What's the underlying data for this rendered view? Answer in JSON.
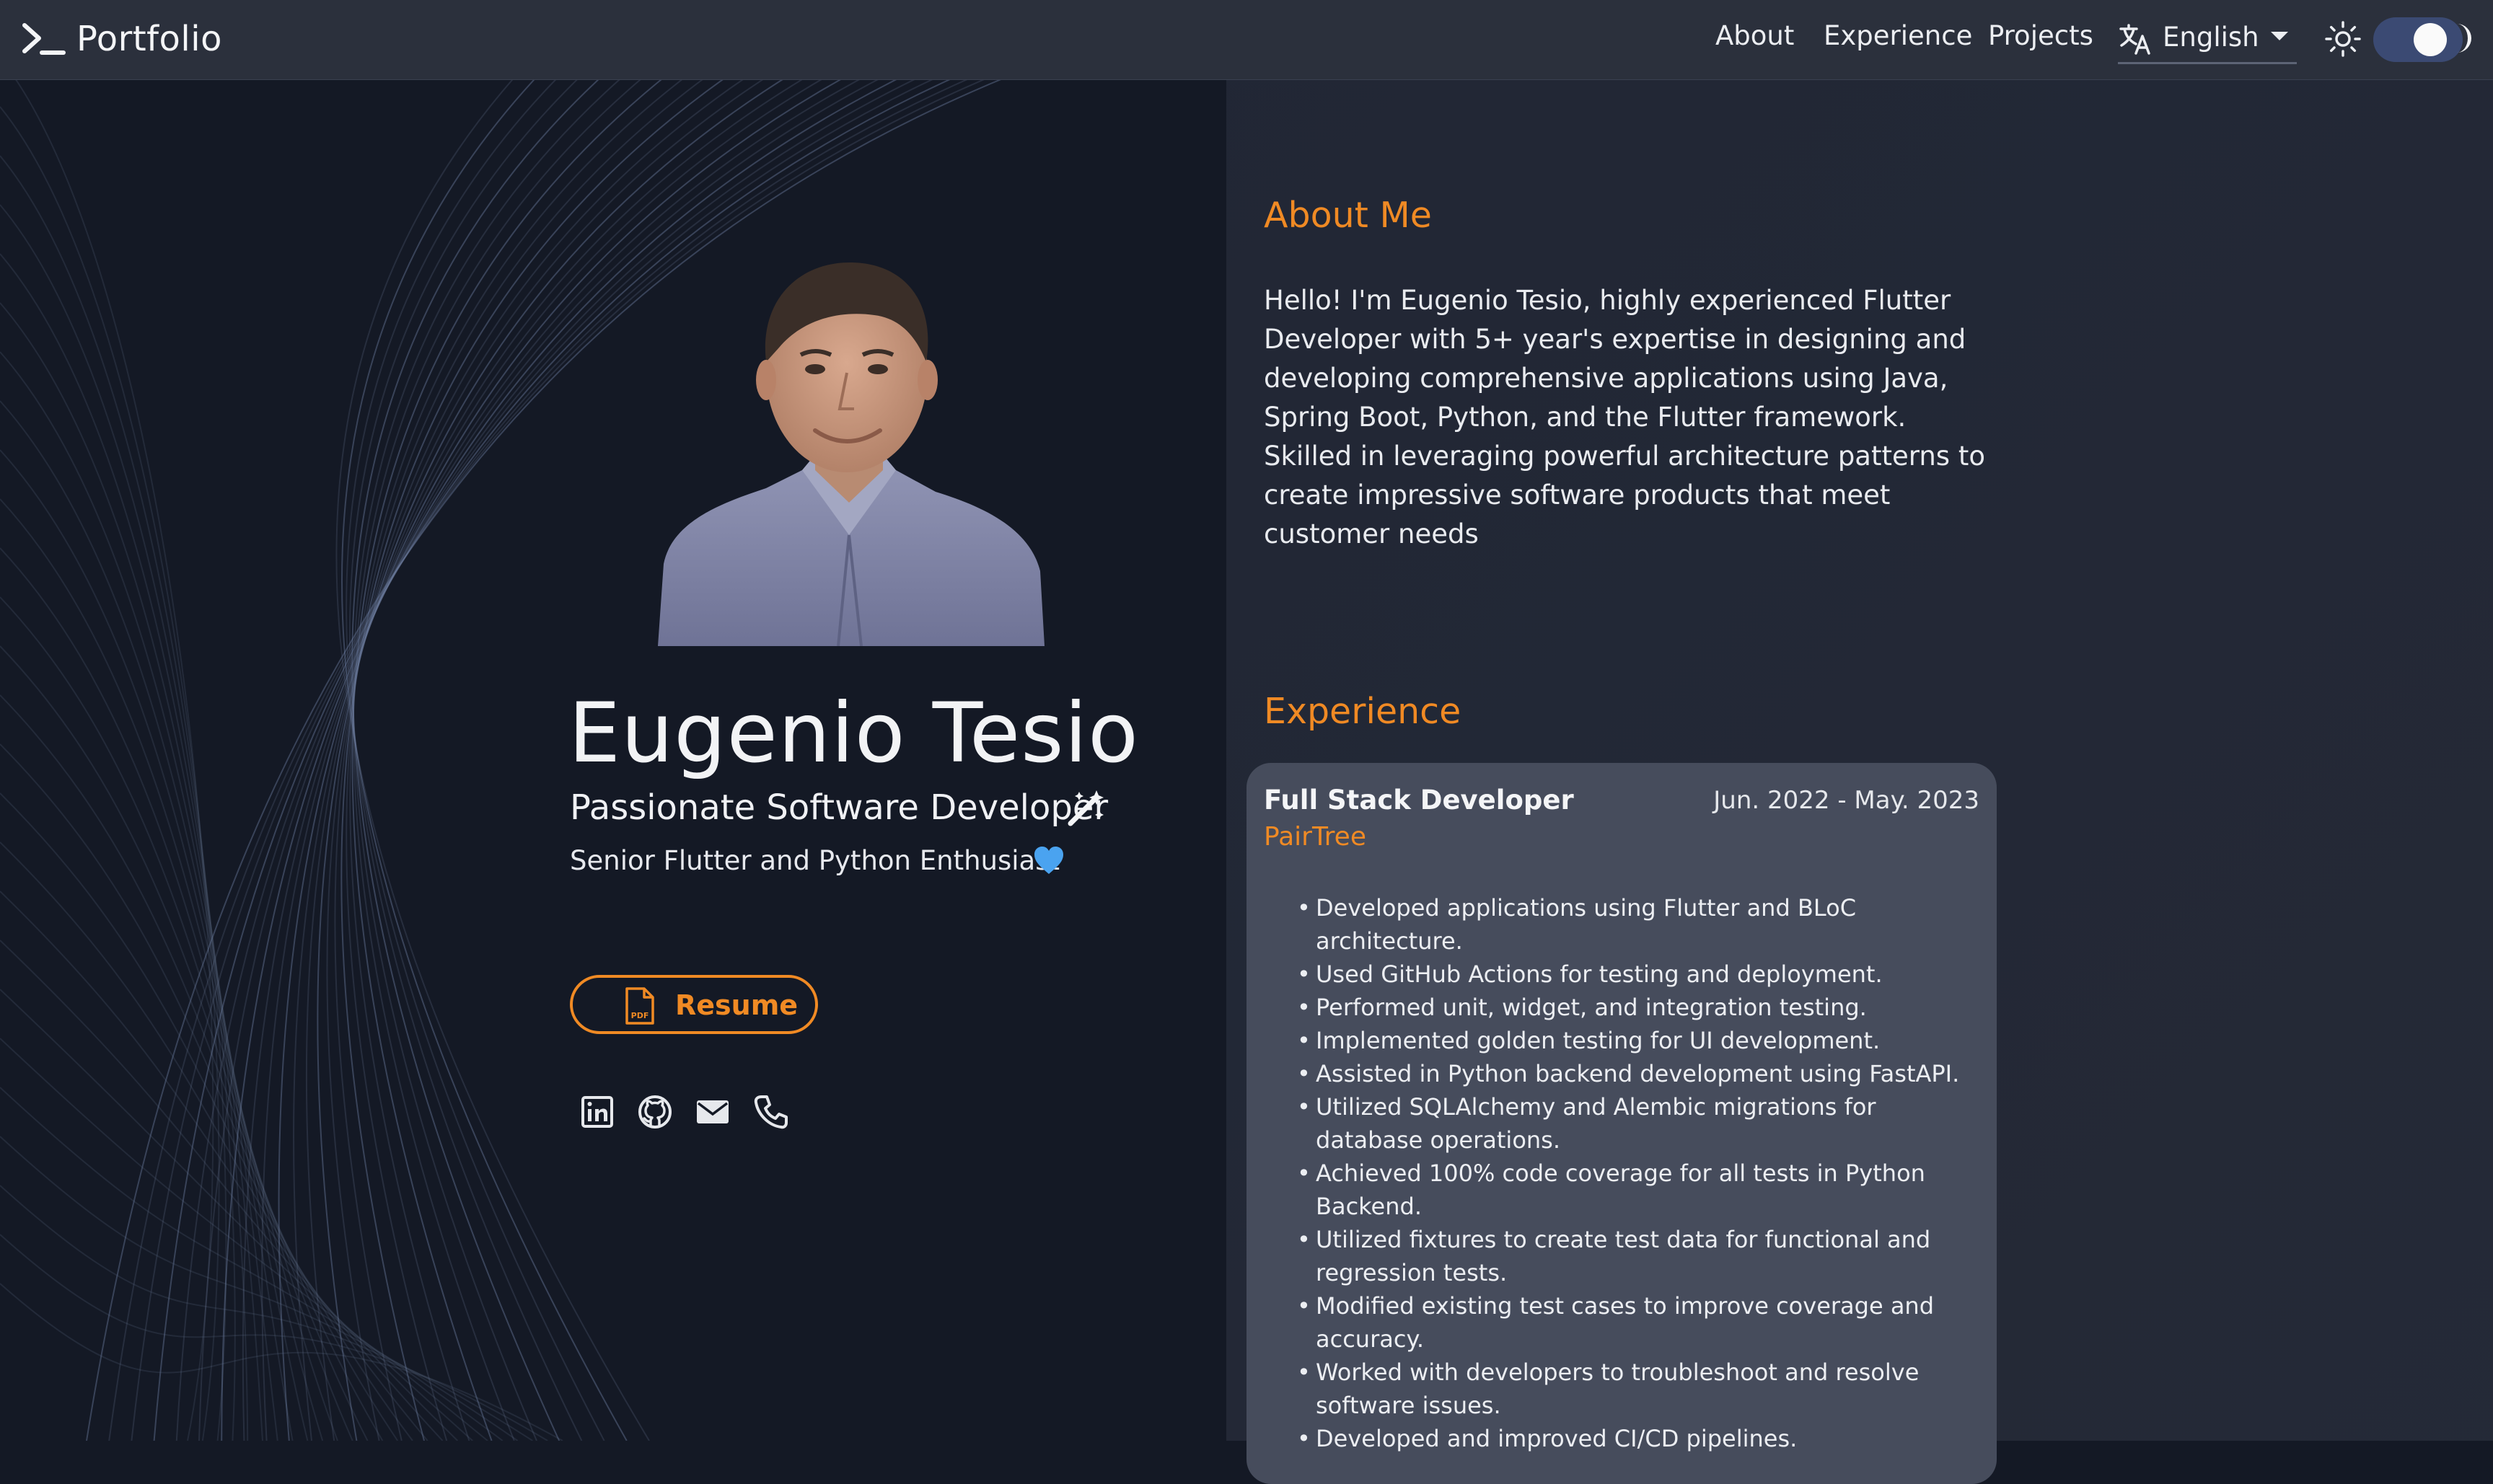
{
  "brand": {
    "text": "Portfolio"
  },
  "nav": {
    "links": [
      "About",
      "Experience",
      "Projects"
    ],
    "language": "English"
  },
  "hero": {
    "name": "Eugenio Tesio",
    "role": "Passionate Software Developer",
    "tagline": "Senior Flutter and Python Enthusiast",
    "resume_label": "Resume",
    "pdf_badge": "PDF",
    "social_icons": [
      "linkedin-icon",
      "github-icon",
      "mail-icon",
      "phone-icon"
    ]
  },
  "about": {
    "title": "About Me",
    "text": "Hello! I'm Eugenio Tesio, highly experienced Flutter Developer with 5+ year's expertise in designing and developing comprehensive applications using Java, Spring Boot, Python, and the Flutter framework. Skilled in leveraging powerful architecture patterns to create impressive software products that meet customer needs"
  },
  "experience": {
    "title": "Experience",
    "jobs": [
      {
        "title": "Full Stack Developer",
        "dates": "Jun. 2022 - May. 2023",
        "company": "PairTree",
        "bullets": [
          "Developed applications using Flutter and BLoC architecture.",
          "Used GitHub Actions for testing and deployment.",
          "Performed unit, widget, and integration testing.",
          "Implemented golden testing for UI development.",
          "Assisted in Python backend development using FastAPI.",
          "Utilized SQLAlchemy and Alembic migrations for database operations.",
          "Achieved 100% code coverage for all tests in Python Backend.",
          "Utilized fixtures to create test data for functional and regression tests.",
          "Modified existing test cases to improve coverage and accuracy.",
          "Worked with developers to troubleshoot and resolve software issues.",
          "Developed and improved CI/CD pipelines."
        ]
      }
    ]
  },
  "colors": {
    "accent": "#f08a24",
    "background": "#141925",
    "navbar": "#2b303c",
    "card": "#464c5c",
    "toggle": "#3b4a73",
    "heart": "#4aa3f0"
  }
}
